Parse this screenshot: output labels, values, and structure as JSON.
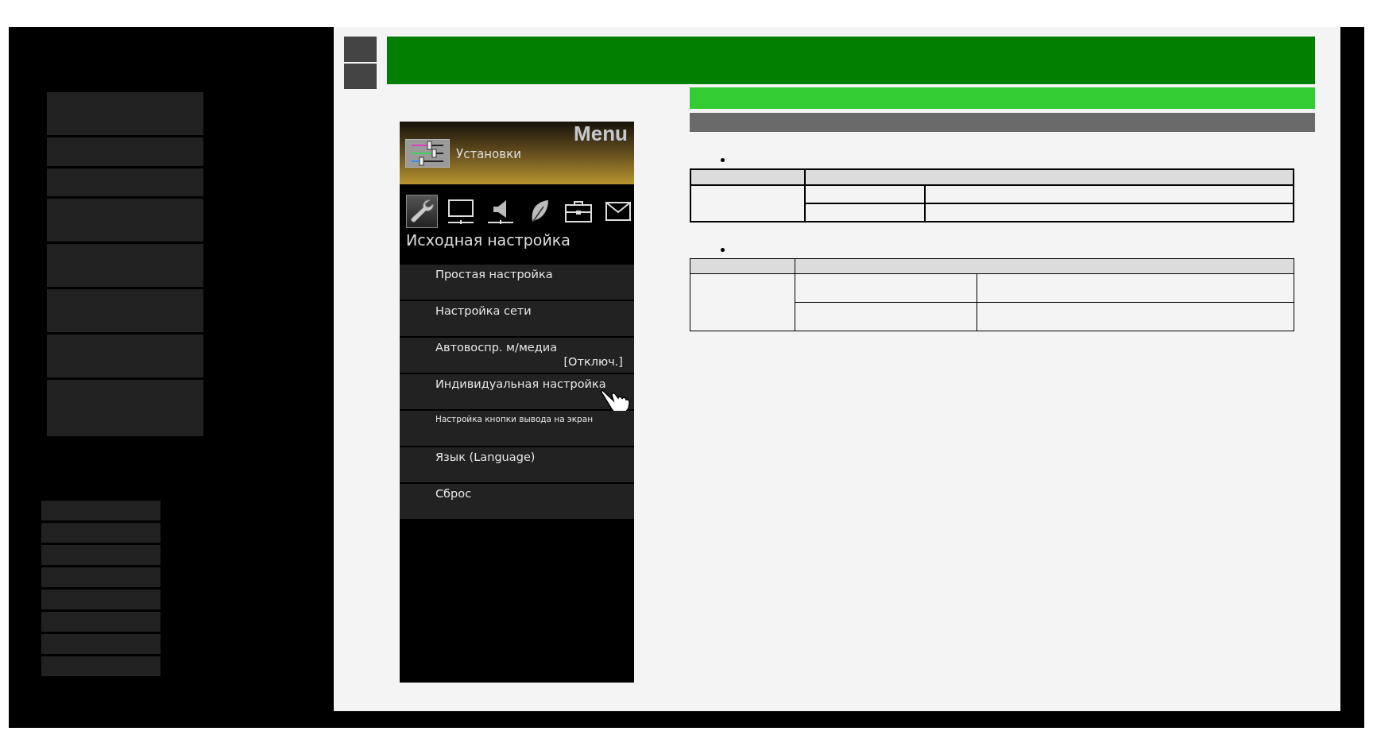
{
  "tv_menu": {
    "title": "Menu",
    "category": "Установки",
    "section": "Исходная настройка",
    "tabs": [
      {
        "kind": "wrench",
        "selected": true
      },
      {
        "kind": "monitor",
        "selected": false
      },
      {
        "kind": "speaker",
        "selected": false
      },
      {
        "kind": "leaf",
        "selected": false
      },
      {
        "kind": "briefcase",
        "selected": false
      },
      {
        "kind": "envelope",
        "selected": false
      }
    ],
    "items": [
      {
        "label": "Простая настройка",
        "small_text": false,
        "pointer": false
      },
      {
        "label": "Настройка сети",
        "small_text": false,
        "pointer": false
      },
      {
        "label": "Автовоспр. м/медиа",
        "value": "[Отключ.]",
        "small_text": false,
        "pointer": false
      },
      {
        "label": "Индивидуальная настройка",
        "small_text": false,
        "pointer": true
      },
      {
        "label": "Настройка кнопки вывода на экран",
        "small_text": true,
        "pointer": false
      },
      {
        "label": "Язык (Language)",
        "small_text": false,
        "pointer": false
      },
      {
        "label": "Сброс",
        "small_text": false,
        "pointer": false
      }
    ]
  }
}
